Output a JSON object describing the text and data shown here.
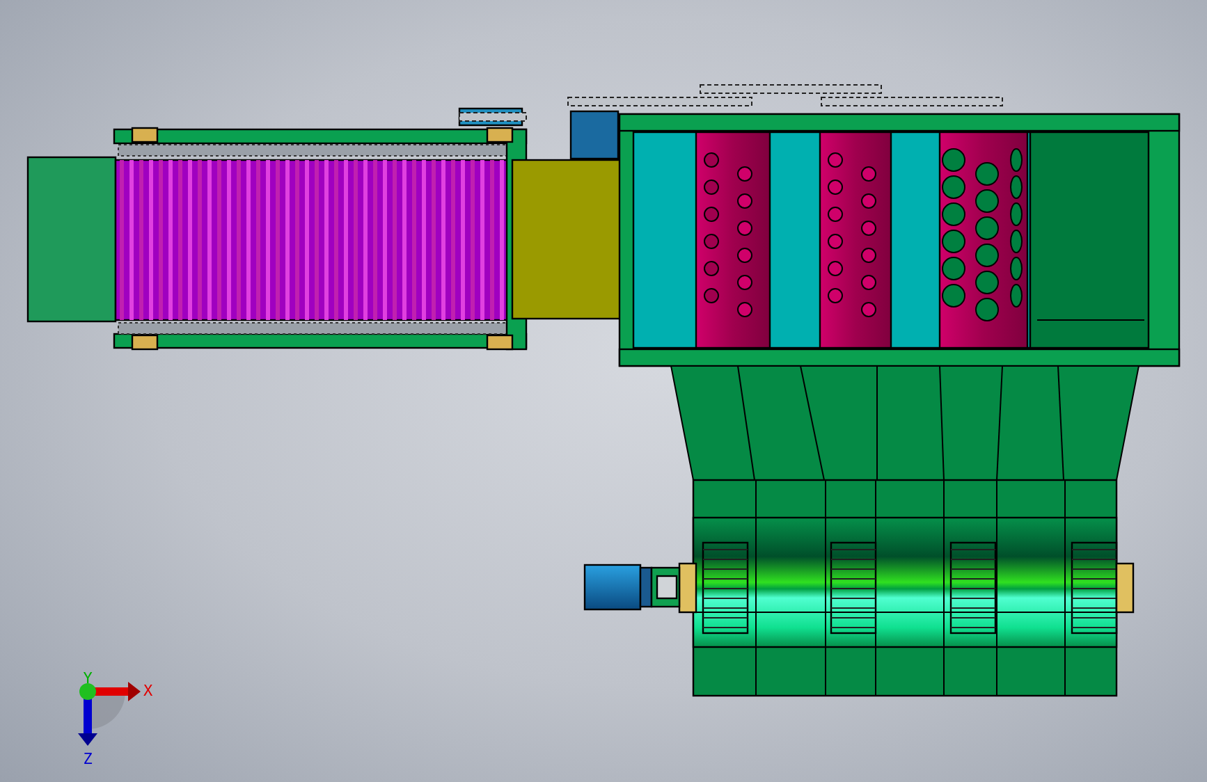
{
  "view_triad": {
    "axes": [
      {
        "kind": "x",
        "label": "X"
      },
      {
        "kind": "y",
        "label": "Y"
      },
      {
        "kind": "z",
        "label": "Z"
      }
    ]
  }
}
